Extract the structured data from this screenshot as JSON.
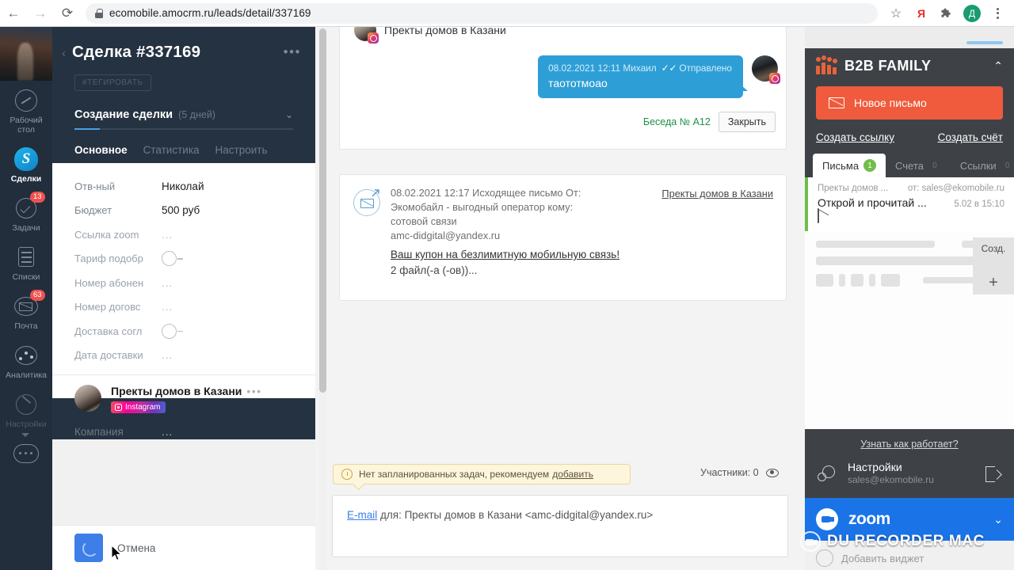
{
  "browser": {
    "back_icon": "back-arrow-icon",
    "forward_icon": "forward-arrow-icon",
    "reload_icon": "reload-icon",
    "url": "ecomobile.amocrm.ru/leads/detail/337169",
    "lock_icon": "lock-icon",
    "star_icon": "bookmark-star-icon",
    "yandex_label": "Я",
    "extensions_icon": "extensions-puzzle-icon",
    "profile_initial": "Д",
    "menu_icon": "kebab-menu-icon"
  },
  "rail": {
    "items": [
      {
        "label": "Рабочий стол",
        "icon": "dashboard-gauge-icon",
        "badge": ""
      },
      {
        "label": "Сделки",
        "icon": "deals-logo-icon",
        "badge": ""
      },
      {
        "label": "Задачи",
        "icon": "tasks-check-icon",
        "badge": "13"
      },
      {
        "label": "Списки",
        "icon": "lists-icon",
        "badge": ""
      },
      {
        "label": "Почта",
        "icon": "mail-icon",
        "badge": "63"
      },
      {
        "label": "Аналитика",
        "icon": "analytics-icon",
        "badge": ""
      },
      {
        "label": "Настройки",
        "icon": "settings-wrench-icon",
        "badge": ""
      }
    ],
    "chat_icon": "chat-bubble-icon"
  },
  "deal": {
    "back_icon": "back-chevron-icon",
    "title": "Сделка #337169",
    "more_icon": "more-dots-icon",
    "tag_button": "#ТЕГИРОВАТЬ",
    "stage_name": "Создание сделки",
    "stage_days": "(5 дней)",
    "stage_chevron_icon": "chevron-down-icon",
    "progress_percent": 11,
    "tabs": [
      {
        "label": "Основное",
        "active": true
      },
      {
        "label": "Статистика",
        "active": false
      },
      {
        "label": "Настроить",
        "active": false
      }
    ],
    "fields": [
      {
        "label": "Отв-ный",
        "value": "Николай",
        "type": "text",
        "muted": false
      },
      {
        "label": "Бюджет",
        "value": "500 руб",
        "type": "text",
        "muted": false
      },
      {
        "label": "Ссылка zoom",
        "value": "...",
        "type": "text",
        "muted": true
      },
      {
        "label": "Тариф подобр",
        "value": "",
        "type": "toggle",
        "muted": true
      },
      {
        "label": "Номер абонен",
        "value": "...",
        "type": "text",
        "muted": true
      },
      {
        "label": "Номер договс",
        "value": "...",
        "type": "text",
        "muted": true
      },
      {
        "label": "Доставка согл",
        "value": "",
        "type": "toggle",
        "muted": true
      },
      {
        "label": "Дата доставки",
        "value": "...",
        "type": "text",
        "muted": true
      }
    ],
    "contact": {
      "name": "Пректы домов в Казани",
      "more_icon": "contact-more-dots-icon",
      "source_badge": "Instagram",
      "avatar_icon": "contact-avatar"
    },
    "company_label": "Компания",
    "company_value": "...",
    "footer": {
      "spinner_icon": "loading-spinner-icon",
      "cancel_label": "Отмена"
    }
  },
  "feed": {
    "chat": {
      "contact_name": "Пректы домов в Казани",
      "avatar_icon": "instagram-avatar",
      "message": {
        "meta": "08.02.2021 12:11 Михаил",
        "status_icon": "double-check-icon",
        "status": "Отправлено",
        "text": "таототмоао",
        "avatar_icon": "sender-instagram-avatar"
      },
      "conversation_label": "Беседа № А12",
      "close_button": "Закрыть"
    },
    "mail": {
      "icon": "outgoing-mail-icon",
      "line1": "08.02.2021 12:17 Исходящее письмо От:",
      "line2": "Экомобайл - выгодный оператор    кому:",
      "line3": "сотовой связи",
      "line4": "amc-didgital@yandex.ru",
      "subject": "Ваш купон на безлимитную мобильную связь!",
      "files": "2 файл(-а (-ов))...",
      "right_link": "Пректы домов в Казани"
    },
    "task_note": {
      "icon": "clock-icon",
      "text": "Нет запланированных задач, рекомендуем",
      "link": "добавить"
    },
    "participants": "Участники: 0",
    "eye_icon": "eye-icon",
    "composer": {
      "channel": "E-mail",
      "target": "для: Пректы домов в Казани <amc-didgital@yandex.ru>"
    }
  },
  "right_panel": {
    "widget": {
      "logo_icon": "b2b-family-logo-icon",
      "title": "B2B FAMILY",
      "collapse_icon": "chevron-up-icon",
      "new_mail_icon": "envelope-icon",
      "new_mail_label": "Новое письмо",
      "link_left": "Создать ссылку",
      "link_right": "Создать счёт"
    },
    "tabs": [
      {
        "label": "Письма",
        "count": "1",
        "active": true
      },
      {
        "label": "Счета",
        "count": "0",
        "active": false
      },
      {
        "label": "Ссылки",
        "count": "0",
        "active": false
      }
    ],
    "mail_item": {
      "contact": "Пректы домов ...",
      "from": "от: sales@ekomobile.ru",
      "subject": "Открой и прочитай ...",
      "time": "5.02 в 15:10",
      "envelope_icon": "unread-envelope-icon"
    },
    "create_column": {
      "label": "Созд.",
      "plus_icon": "plus-icon"
    },
    "howto_link": "Узнать как работает?",
    "settings": {
      "gear_icon": "gear-icon",
      "title": "Настройки",
      "account": "sales@ekomobile.ru",
      "logout_icon": "logout-icon"
    },
    "zoom_widget": {
      "icon": "zoom-camera-icon",
      "label": "zoom",
      "chevron_icon": "chevron-down-icon"
    },
    "add_widget_label": "Добавить виджет"
  },
  "watermark": {
    "icon": "du-recorder-icon",
    "text": "DU RECORDER MAC"
  }
}
